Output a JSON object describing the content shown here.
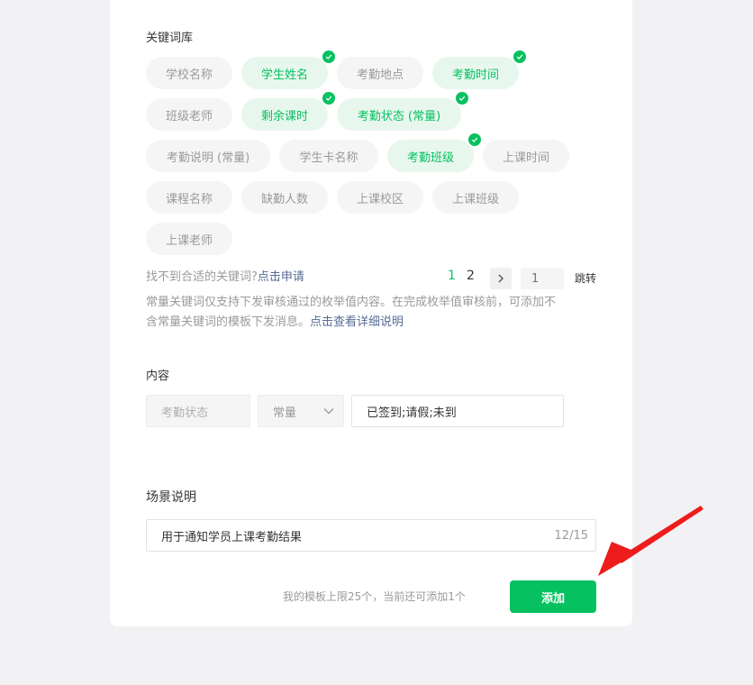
{
  "keywords": {
    "label": "关键词库",
    "chips": [
      {
        "label": "学校名称",
        "selected": false
      },
      {
        "label": "学生姓名",
        "selected": true
      },
      {
        "label": "考勤地点",
        "selected": false
      },
      {
        "label": "考勤时间",
        "selected": true
      },
      {
        "label": "班级老师",
        "selected": false
      },
      {
        "label": "剩余课时",
        "selected": true
      },
      {
        "label": "考勤状态 (常量)",
        "selected": true
      },
      {
        "label": "考勤说明 (常量)",
        "selected": false
      },
      {
        "label": "学生卡名称",
        "selected": false
      },
      {
        "label": "考勤班级",
        "selected": true
      },
      {
        "label": "上课时间",
        "selected": false
      },
      {
        "label": "课程名称",
        "selected": false
      },
      {
        "label": "缺勤人数",
        "selected": false
      },
      {
        "label": "上课校区",
        "selected": false
      },
      {
        "label": "上课班级",
        "selected": false
      },
      {
        "label": "上课老师",
        "selected": false
      }
    ],
    "not_found_text": "找不到合适的关键词?",
    "apply_link": "点击申请",
    "note_line1": "常量关键词仅支持下发审核通过的枚举值内容。在完成枚举值审核前，可添加不",
    "note_line2": "含常量关键词的模板下发消息。",
    "detail_link": "点击查看详细说明"
  },
  "pagination": {
    "current": "1",
    "page2": "2",
    "next_icon": "chevron-right-icon",
    "jump_placeholder": "1",
    "jump_label": "跳转"
  },
  "content": {
    "label": "内容",
    "keyword_value": "考勤状态",
    "type_value": "常量",
    "enum_value": "已签到;请假;未到"
  },
  "scene": {
    "label": "场景说明",
    "value": "用于通知学员上课考勤结果",
    "counter": "12/15"
  },
  "footer": {
    "limit_text": "我的模板上限25个，当前还可添加1个",
    "add_label": "添加"
  },
  "colors": {
    "accent": "#07c160",
    "arrow": "#ee1c1c",
    "link": "#576b95"
  }
}
